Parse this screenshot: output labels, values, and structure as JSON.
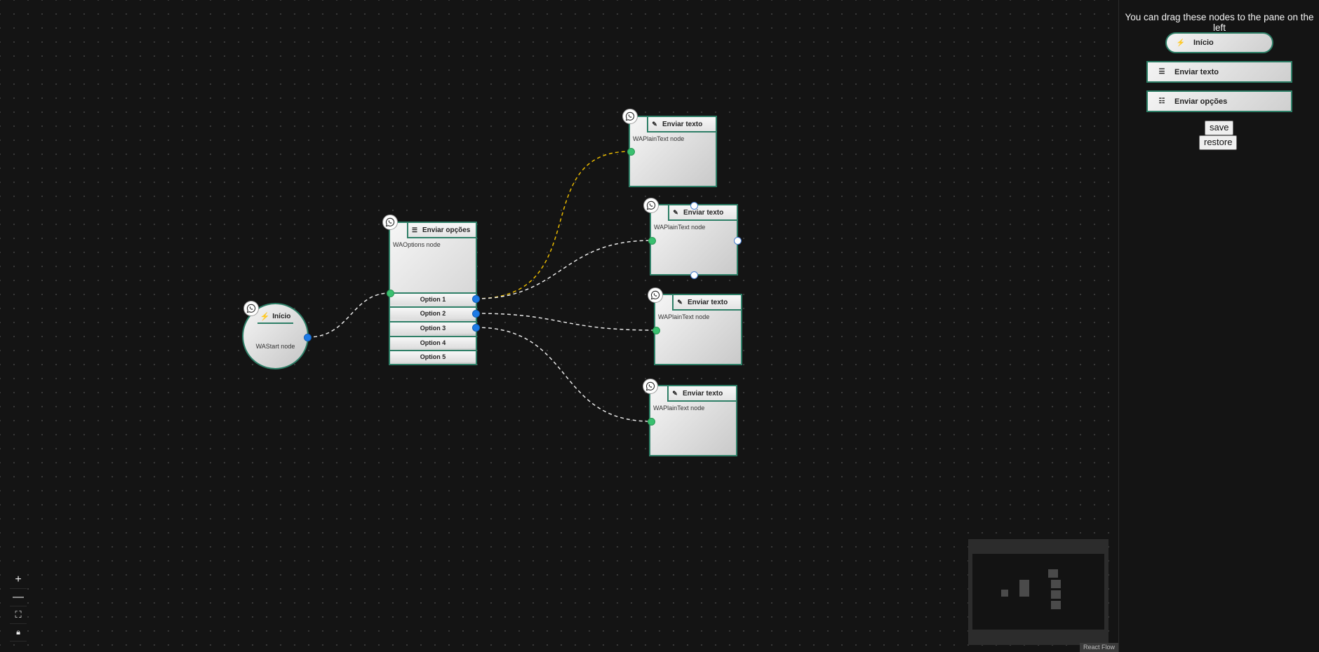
{
  "sidebar": {
    "title": "You can drag these nodes to the pane on the left",
    "items": [
      {
        "label": "Início",
        "icon": "bolt-icon"
      },
      {
        "label": "Enviar texto",
        "icon": "text-icon"
      },
      {
        "label": "Enviar opções",
        "icon": "list-icon"
      }
    ],
    "save_label": "save",
    "restore_label": "restore"
  },
  "nodes": {
    "start": {
      "title": "Início",
      "subtitle": "WAStart node"
    },
    "options": {
      "title": "Enviar opções",
      "subtitle": "WAOptions node",
      "options": [
        "Option 1",
        "Option 2",
        "Option 3",
        "Option 4",
        "Option 5"
      ]
    },
    "text1": {
      "title": "Enviar texto",
      "subtitle": "WAPlainText node"
    },
    "text2": {
      "title": "Enviar texto",
      "subtitle": "WAPlainText node"
    },
    "text3": {
      "title": "Enviar texto",
      "subtitle": "WAPlainText node"
    },
    "text4": {
      "title": "Enviar texto",
      "subtitle": "WAPlainText node"
    }
  },
  "controls": [
    "zoom-in",
    "zoom-out",
    "fit-view",
    "lock"
  ],
  "attribution": "React Flow",
  "colors": {
    "background": "#141414",
    "node_border": "#2e7f67",
    "edge_selected": "#e6b800",
    "edge": "#e8e8e8",
    "handle_source": "#1e7be6",
    "handle_target": "#3ac070"
  }
}
